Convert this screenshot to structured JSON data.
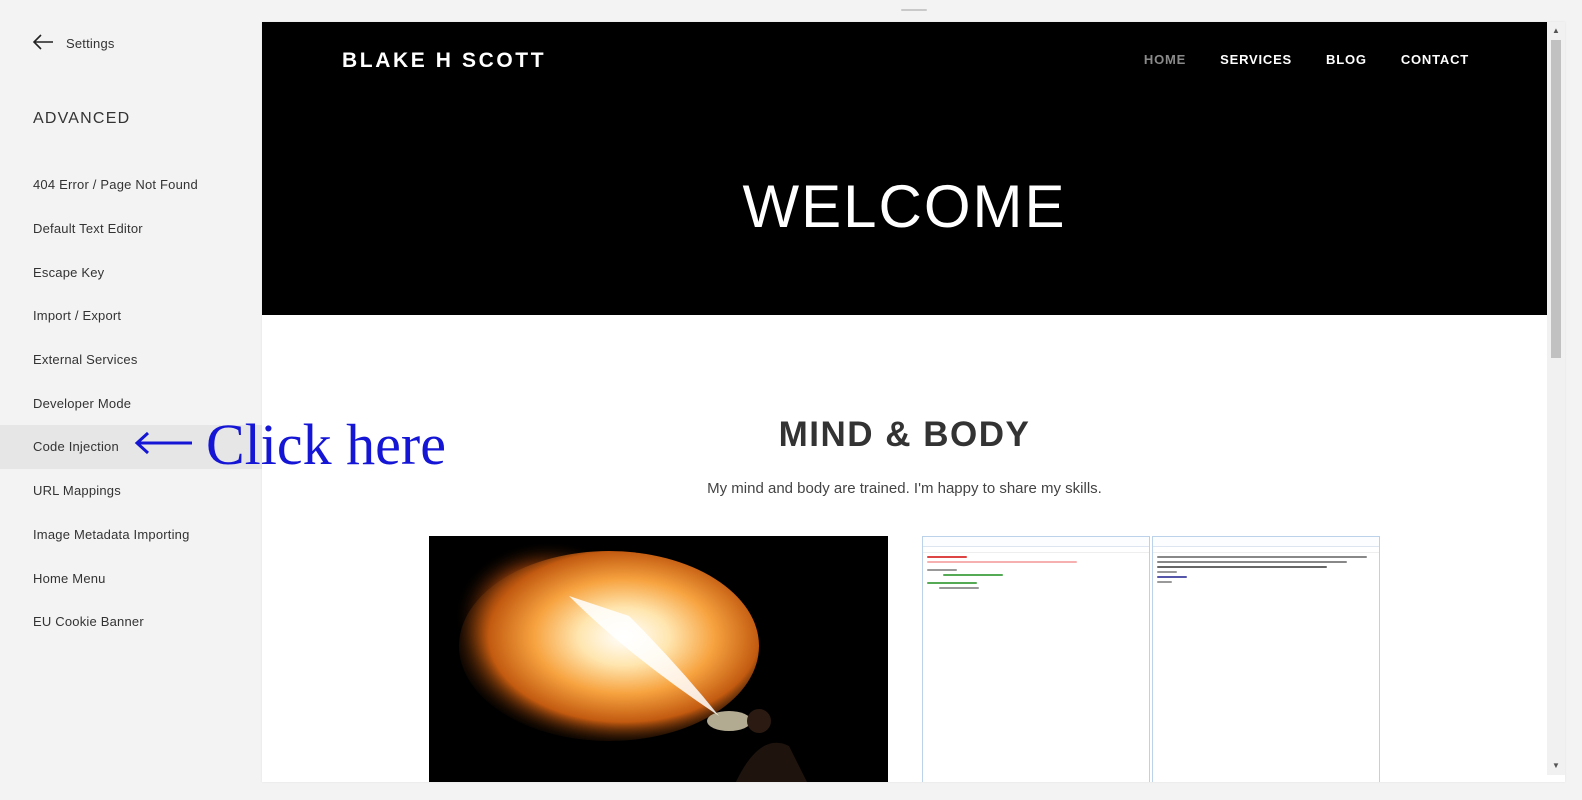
{
  "sidebar": {
    "back_label": "Settings",
    "section_title": "ADVANCED",
    "items": [
      {
        "label": "404 Error / Page Not Found"
      },
      {
        "label": "Default Text Editor"
      },
      {
        "label": "Escape Key"
      },
      {
        "label": "Import / Export"
      },
      {
        "label": "External Services"
      },
      {
        "label": "Developer Mode"
      },
      {
        "label": "Code Injection"
      },
      {
        "label": "URL Mappings"
      },
      {
        "label": "Image Metadata Importing"
      },
      {
        "label": "Home Menu"
      },
      {
        "label": "EU Cookie Banner"
      }
    ],
    "active_item": "Code Injection"
  },
  "annotation": {
    "text": "Click here",
    "color": "#1515d6"
  },
  "site": {
    "logo": "BLAKE H SCOTT",
    "nav": [
      "HOME",
      "SERVICES",
      "BLOG",
      "CONTACT"
    ],
    "current_nav": "HOME",
    "hero_title": "WELCOME",
    "section_heading": "MIND & BODY",
    "section_subtitle": "My mind and body are trained. I'm happy to share my skills."
  }
}
